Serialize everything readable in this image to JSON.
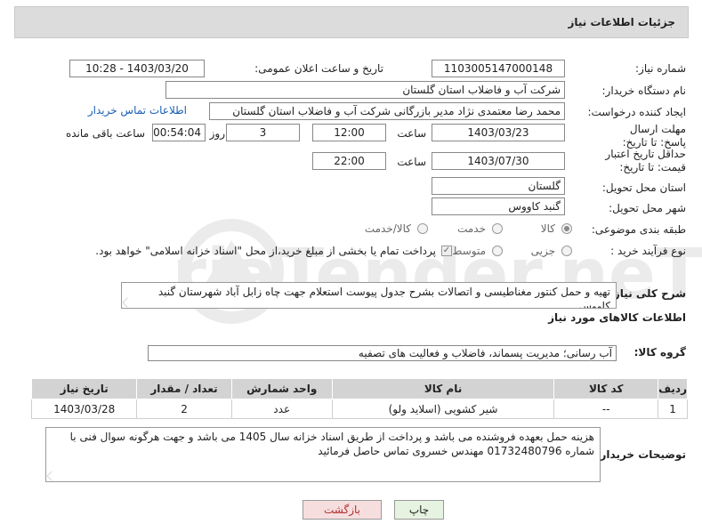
{
  "header": {
    "title": "جزئیات اطلاعات نیاز"
  },
  "form": {
    "need_number_label": "شماره نیاز:",
    "need_number": "1103005147000148",
    "announce_label": "تاریخ و ساعت اعلان عمومی:",
    "announce_value": "1403/03/20 - 10:28",
    "buyer_org_label": "نام دستگاه خریدار:",
    "buyer_org": "شرکت آب و فاضلاب استان گلستان",
    "creator_label": "ایجاد کننده درخواست:",
    "creator": "محمد رضا معتمدی نژاد مدیر بازرگانی شرکت آب و فاضلاب استان گلستان",
    "contact_link": "اطلاعات تماس خریدار",
    "reply_deadline_label": "مهلت ارسال پاسخ: تا تاریخ:",
    "reply_date": "1403/03/23",
    "time_label": "ساعت",
    "reply_time": "12:00",
    "days_value": "3",
    "days_label": "روز و",
    "remaining_time": "00:54:04",
    "remaining_label": "ساعت باقی مانده",
    "validity_label": "حداقل تاریخ اعتبار قیمت: تا تاریخ:",
    "validity_date": "1403/07/30",
    "validity_time": "22:00",
    "province_label": "استان محل تحویل:",
    "province": "گلستان",
    "city_label": "شهر محل تحویل:",
    "city": "گنبد کاووس",
    "category_label": "طبقه بندی موضوعی:",
    "category_options": [
      "کالا",
      "خدمت",
      "کالا/خدمت"
    ],
    "category_selected": "کالا",
    "process_label": "نوع فرآیند خرید :",
    "process_options": [
      "جزیی",
      "متوسط"
    ],
    "process_note": "پرداخت تمام یا بخشی از مبلغ خرید،از محل \"اسناد خزانه اسلامی\" خواهد بود."
  },
  "description": {
    "label": "شرح کلی نیاز:",
    "text": "تهیه و حمل کنتور مغناطیسی و اتصالات بشرح جدول پیوست استعلام جهت چاه زابل آباد شهرستان گنبد کاووس"
  },
  "goods_section": {
    "title": "اطلاعات کالاهای مورد نیاز",
    "group_label": "گروه کالا:",
    "group_value": "آب رسانی؛ مدیریت پسماند، فاضلاب و فعالیت های تصفیه"
  },
  "table": {
    "headers": [
      "ردیف",
      "کد کالا",
      "نام کالا",
      "واحد شمارش",
      "تعداد / مقدار",
      "تاریخ نیاز"
    ],
    "rows": [
      [
        "1",
        "--",
        "شیر کشویی (اسلاید ولو)",
        "عدد",
        "2",
        "1403/03/28"
      ]
    ]
  },
  "buyer_notes": {
    "label": "توضیحات خریدار:",
    "text": "هزینه حمل بعهده فروشنده می باشد و پرداخت از طریق اسناد خزانه سال 1405 می باشد و جهت هرگونه سوال فنی با شماره 01732480796 مهندس خسروی تماس حاصل فرمائید"
  },
  "buttons": {
    "print": "چاپ",
    "back": "بازگشت"
  },
  "watermark": {
    "text": "AriaTender.neT"
  },
  "colors": {
    "link": "#1a5fb4",
    "header_bg": "#dcdcdc",
    "back_button_bg": "#f7dede",
    "print_button_bg": "#e6f3e0"
  }
}
